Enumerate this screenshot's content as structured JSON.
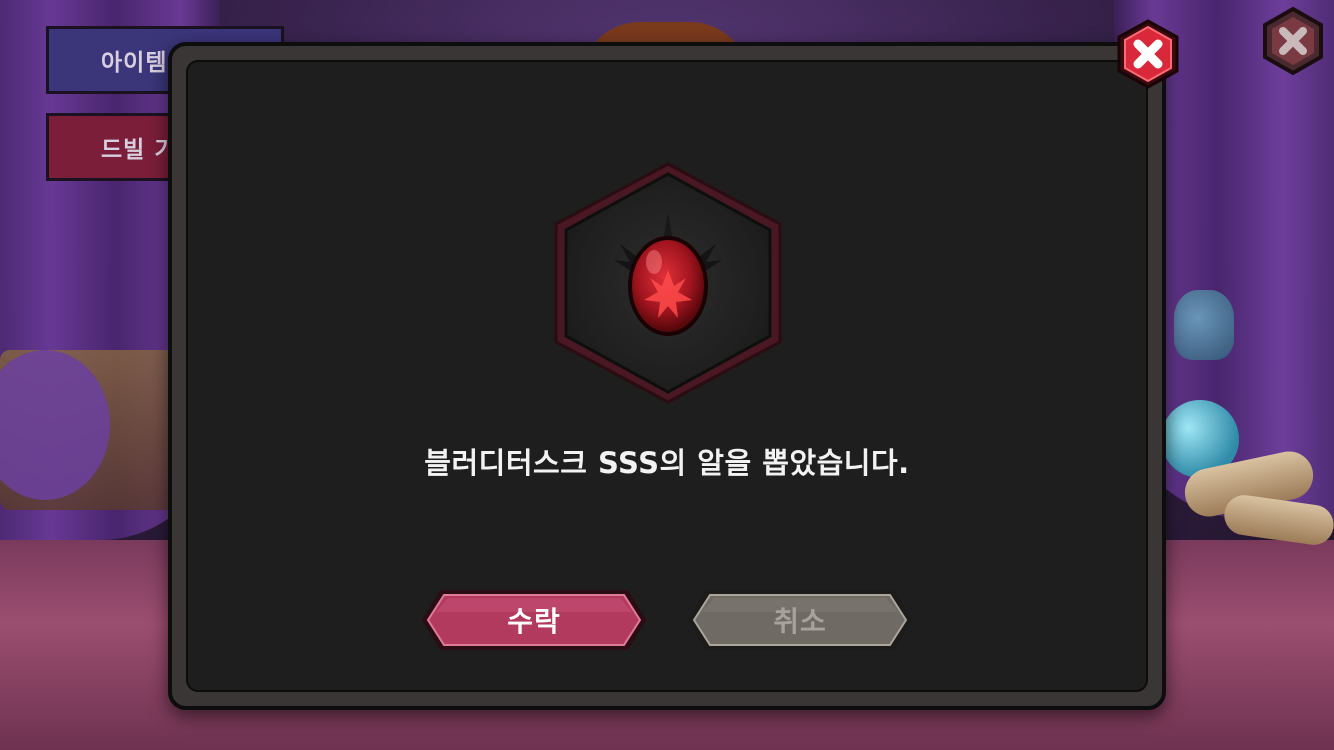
{
  "background": {
    "side_buttons": [
      "아이템코",
      "드빌 기"
    ]
  },
  "dialog": {
    "item_icon": "dragon-egg-icon",
    "message": "블러디터스크 SSS의 알을 뽑았습니다.",
    "accept_label": "수락",
    "cancel_label": "취소",
    "close_icon": "close-icon"
  },
  "colors": {
    "accept": "#b23a5e",
    "cancel": "#6f6a64",
    "close": "#d8283a",
    "panel": "#1e1e1e"
  }
}
